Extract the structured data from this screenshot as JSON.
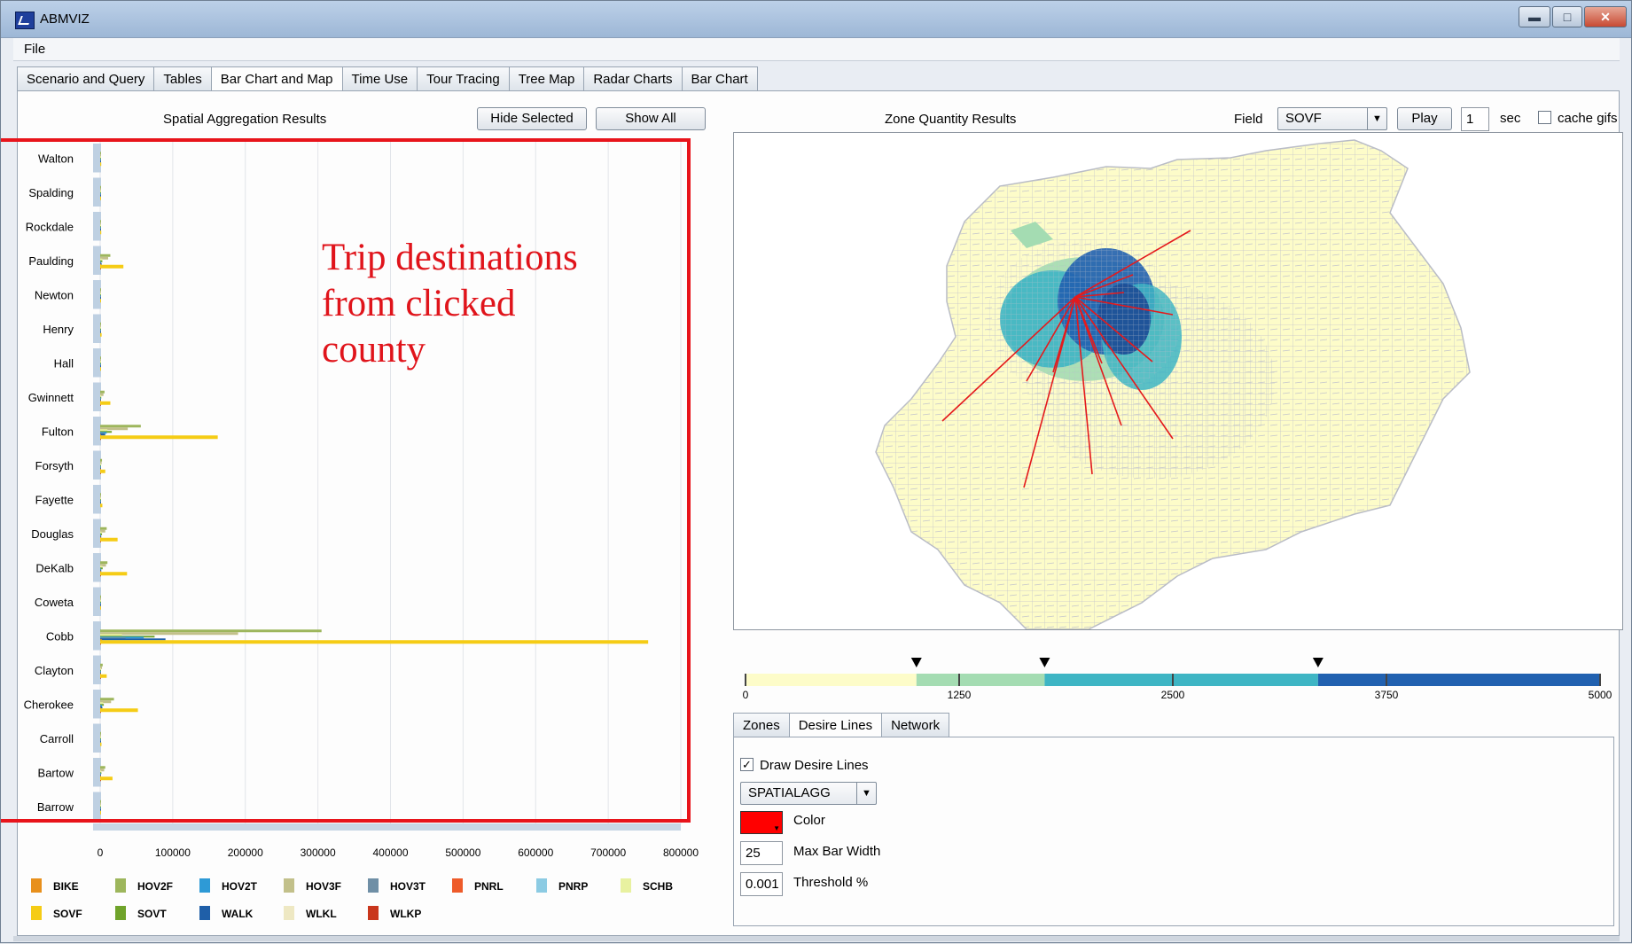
{
  "window": {
    "title": "ABMVIZ"
  },
  "menu": {
    "file": "File"
  },
  "tabs": [
    "Scenario and Query",
    "Tables",
    "Bar Chart and Map",
    "Time Use",
    "Tour Tracing",
    "Tree Map",
    "Radar Charts",
    "Bar Chart"
  ],
  "active_tab": "Bar Chart and Map",
  "left_panel": {
    "title": "Spatial Aggregation Results",
    "hide_selected": "Hide Selected",
    "show_all": "Show All"
  },
  "annotation": {
    "text": "Trip destinations from clicked county",
    "color": "#e0141b"
  },
  "chart_data": {
    "type": "bar",
    "orientation": "horizontal",
    "title": "Spatial Aggregation Results",
    "categories": [
      "Walton",
      "Spalding",
      "Rockdale",
      "Paulding",
      "Newton",
      "Henry",
      "Hall",
      "Gwinnett",
      "Fulton",
      "Forsyth",
      "Fayette",
      "Douglas",
      "DeKalb",
      "Coweta",
      "Cobb",
      "Clayton",
      "Cherokee",
      "Carroll",
      "Bartow",
      "Barrow"
    ],
    "xlim": [
      0,
      800000
    ],
    "x_ticks": [
      "0",
      "100000",
      "200000",
      "300000",
      "400000",
      "500000",
      "600000",
      "700000",
      "800000"
    ],
    "grid": true,
    "legend_position": "bottom",
    "series": [
      {
        "name": "BIKE",
        "color": "#e8901c",
        "values": [
          0,
          0,
          0,
          300,
          0,
          0,
          0,
          200,
          1200,
          100,
          0,
          200,
          300,
          0,
          2500,
          150,
          300,
          0,
          150,
          0
        ]
      },
      {
        "name": "HOV2F",
        "color": "#9db65c",
        "values": [
          500,
          200,
          500,
          14000,
          300,
          600,
          200,
          6000,
          56000,
          2500,
          1000,
          9000,
          10000,
          200,
          305000,
          3500,
          19000,
          600,
          7000,
          300
        ]
      },
      {
        "name": "HOV2T",
        "color": "#2e9ad6",
        "values": [
          100,
          50,
          100,
          1500,
          50,
          80,
          30,
          800,
          9000,
          400,
          150,
          1200,
          1500,
          50,
          60000,
          500,
          2500,
          80,
          1000,
          50
        ]
      },
      {
        "name": "HOV3F",
        "color": "#c2c08a",
        "values": [
          400,
          150,
          400,
          11000,
          250,
          500,
          150,
          4500,
          38000,
          2000,
          800,
          7000,
          8000,
          150,
          190000,
          2500,
          15000,
          500,
          5500,
          250
        ]
      },
      {
        "name": "HOV3T",
        "color": "#6f8fa6",
        "values": [
          50,
          20,
          50,
          800,
          20,
          40,
          10,
          400,
          5000,
          200,
          80,
          600,
          800,
          20,
          35000,
          300,
          1200,
          40,
          500,
          20
        ]
      },
      {
        "name": "PNRL",
        "color": "#ee5b2a",
        "values": [
          0,
          0,
          0,
          50,
          0,
          0,
          0,
          30,
          600,
          10,
          0,
          20,
          100,
          0,
          400,
          20,
          40,
          0,
          20,
          0
        ]
      },
      {
        "name": "PNRP",
        "color": "#8ccbe3",
        "values": [
          0,
          0,
          0,
          100,
          0,
          0,
          0,
          50,
          1500,
          20,
          0,
          40,
          300,
          0,
          800,
          40,
          80,
          0,
          40,
          0
        ]
      },
      {
        "name": "SCHB",
        "color": "#e8f1a0",
        "values": [
          200,
          100,
          200,
          3000,
          100,
          200,
          100,
          1500,
          10000,
          800,
          300,
          2000,
          3000,
          100,
          30000,
          1000,
          4000,
          200,
          1500,
          100
        ]
      },
      {
        "name": "SOVF",
        "color": "#f5cc15",
        "values": [
          1500,
          600,
          1500,
          32000,
          900,
          2000,
          600,
          14000,
          162000,
          7000,
          3000,
          24000,
          37000,
          600,
          755000,
          9000,
          52000,
          1800,
          17000,
          900
        ]
      },
      {
        "name": "SOVT",
        "color": "#6fa32a",
        "values": [
          200,
          80,
          200,
          3000,
          100,
          250,
          80,
          1500,
          16000,
          700,
          300,
          2500,
          3500,
          80,
          75000,
          900,
          5000,
          200,
          1700,
          100
        ]
      },
      {
        "name": "WALK",
        "color": "#1f5fa8",
        "values": [
          100,
          30,
          100,
          2000,
          50,
          100,
          30,
          800,
          7000,
          300,
          100,
          1500,
          1500,
          30,
          90000,
          400,
          3000,
          100,
          1000,
          50
        ]
      },
      {
        "name": "WLKL",
        "color": "#eee8c3",
        "values": [
          0,
          0,
          0,
          50,
          0,
          0,
          0,
          40,
          900,
          10,
          0,
          30,
          300,
          0,
          500,
          40,
          50,
          0,
          20,
          0
        ]
      },
      {
        "name": "WLKP",
        "color": "#c9361c",
        "values": [
          0,
          0,
          0,
          30,
          0,
          0,
          0,
          20,
          600,
          10,
          0,
          20,
          200,
          0,
          300,
          20,
          30,
          0,
          10,
          0
        ]
      }
    ]
  },
  "right_panel": {
    "title": "Zone Quantity Results",
    "field_label": "Field",
    "field_value": "SOVF",
    "play": "Play",
    "seconds_value": "1",
    "seconds_label": "sec",
    "cache_gifs": "cache gifs",
    "cache_gifs_checked": false
  },
  "color_scale": {
    "ticks": [
      "0",
      "1250",
      "2500",
      "3750",
      "5000"
    ],
    "min": 0,
    "max": 5000,
    "breaks": [
      1000,
      1750,
      3350
    ],
    "colors": [
      "#fdfcc9",
      "#a4dcb2",
      "#3eb5c4",
      "#2161b0"
    ]
  },
  "subtabs": [
    "Zones",
    "Desire Lines",
    "Network"
  ],
  "active_subtab": "Desire Lines",
  "desire_lines": {
    "draw_label": "Draw Desire Lines",
    "draw_checked": true,
    "layer_value": "SPATIALAGG",
    "color_label": "Color",
    "color_value": "#ff0000",
    "max_bar_width_value": "25",
    "max_bar_width_label": "Max Bar Width",
    "threshold_value": "0.001",
    "threshold_label": "Threshold %"
  }
}
